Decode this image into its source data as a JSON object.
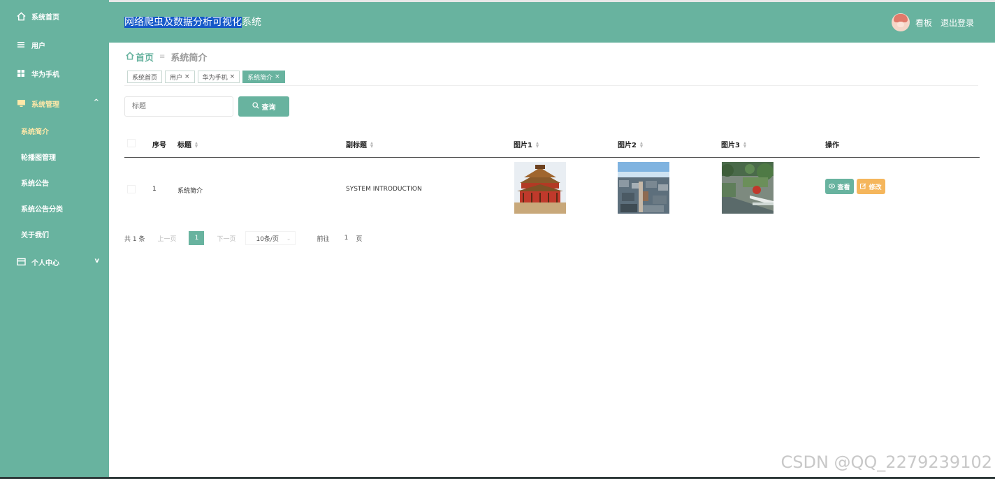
{
  "sidebar": {
    "items": [
      {
        "label": "系统首页",
        "icon": "home-icon"
      },
      {
        "label": "用户",
        "icon": "menu-lines-icon"
      },
      {
        "label": "华为手机",
        "icon": "grid-icon"
      },
      {
        "label": "系统管理",
        "icon": "monitor-icon"
      },
      {
        "label": "个人中心",
        "icon": "card-icon"
      }
    ],
    "subitems": [
      "系统简介",
      "轮播图管理",
      "系统公告",
      "系统公告分类",
      "关于我们"
    ]
  },
  "header": {
    "title_selected": "网络爬虫及数据分析可视化",
    "title_rest": "系统",
    "user_name": "看板",
    "logout": "退出登录"
  },
  "breadcrumb": {
    "home": "首页",
    "current": "系统简介"
  },
  "tags": [
    {
      "label": "系统首页",
      "closable": false
    },
    {
      "label": "用户",
      "closable": true
    },
    {
      "label": "华为手机",
      "closable": true
    },
    {
      "label": "系统简介",
      "closable": true,
      "active": true
    }
  ],
  "search": {
    "placeholder": "标题",
    "button": "查询"
  },
  "table": {
    "headers": [
      "序号",
      "标题",
      "副标题",
      "图片1",
      "图片2",
      "图片3",
      "操作"
    ],
    "rows": [
      {
        "index": "1",
        "title": "系统简介",
        "subtitle": "SYSTEM INTRODUCTION",
        "view": "查看",
        "edit": "修改"
      }
    ]
  },
  "pager": {
    "total": "共 1 条",
    "prev": "上一页",
    "page": "1",
    "next": "下一页",
    "size": "10条/页",
    "goto": "前往",
    "goto_value": "1",
    "unit": "页"
  },
  "watermark": "CSDN @QQ_2279239102",
  "colors": {
    "primary": "#68b39f",
    "edit": "#f5b65c",
    "selection": "#1558c8"
  }
}
